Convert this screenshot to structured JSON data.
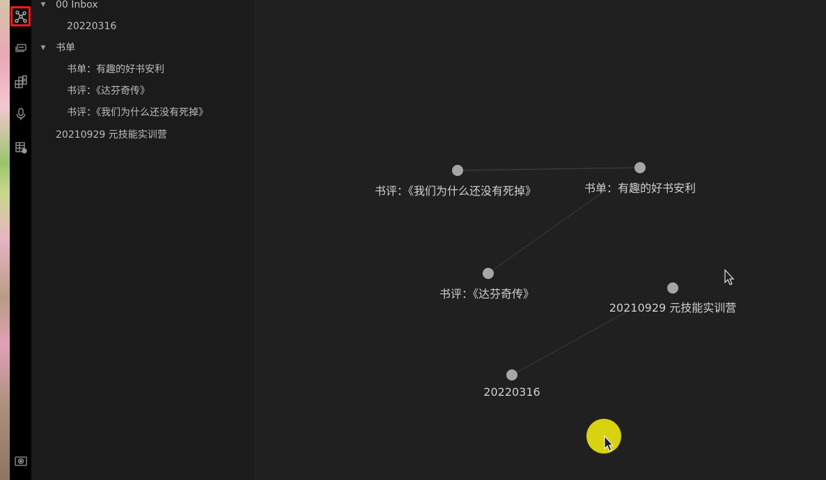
{
  "ribbon": {
    "items": [
      {
        "icon": "graph-view-icon",
        "active": true
      },
      {
        "icon": "slides-icon",
        "active": false
      },
      {
        "icon": "canvas-blocks-icon",
        "active": false
      },
      {
        "icon": "microphone-icon",
        "active": false
      },
      {
        "icon": "table-settings-icon",
        "active": false
      }
    ],
    "bottom_icon": "vault-icon",
    "accent": "#ff1a1a"
  },
  "explorer": {
    "folders": [
      {
        "label": "00 Inbox",
        "expanded": true,
        "children": [
          "20220316"
        ]
      },
      {
        "label": "书单",
        "expanded": true,
        "children": [
          "书单：有趣的好书安利",
          "书评：《达芬奇传》",
          "书评：《我们为什么还没有死掉》"
        ]
      }
    ],
    "root_files": [
      "20210929 元技能实训营"
    ]
  },
  "graph": {
    "nodes": [
      {
        "id": "n1",
        "label": "书评：《我们为什么还没有死掉》"
      },
      {
        "id": "n2",
        "label": "书单：有趣的好书安利"
      },
      {
        "id": "n3",
        "label": "书评：《达芬奇传》"
      },
      {
        "id": "n4",
        "label": "20210929 元技能实训营"
      },
      {
        "id": "n5",
        "label": "20220316"
      }
    ],
    "links": [
      [
        "n1",
        "n2"
      ],
      [
        "n2",
        "n3"
      ],
      [
        "n4",
        "n5"
      ]
    ],
    "node_color": "#a6a6a6",
    "link_color": "#3a3a3a",
    "cursor_highlight_color": "#d8d20f"
  }
}
